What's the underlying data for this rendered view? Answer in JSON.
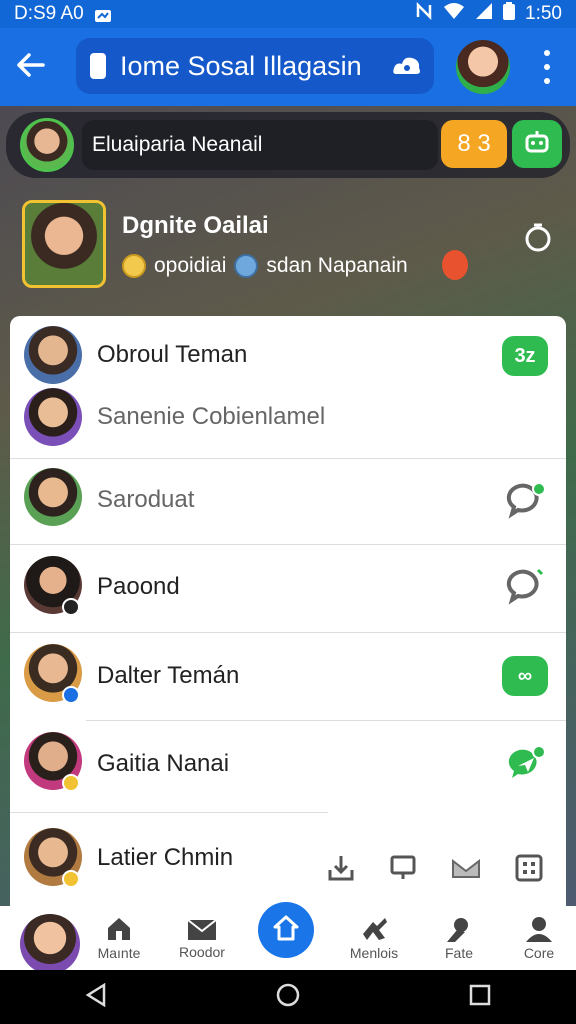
{
  "status_bar": {
    "time": "D:S9 A0",
    "clock_right": "1:50",
    "icons": [
      "message-icon",
      "nfc-icon",
      "wifi-icon",
      "signal-icon",
      "battery-icon"
    ]
  },
  "app_bar": {
    "title": "Iome Sosal Illagasin",
    "icons": [
      "back-arrow-icon",
      "cloud-icon",
      "more-vert-icon"
    ]
  },
  "search": {
    "value": "Eluaiparia Neanail",
    "badge_count": "8 3"
  },
  "profile": {
    "name": "Dgnite Oailai",
    "sub1": "opoidiai",
    "sub2": "sdan Napanain"
  },
  "list": [
    {
      "name": "Obroul Teman",
      "badge": "3z",
      "style": "normal"
    },
    {
      "name": "Sanenie Cobienlamel",
      "style": "muted"
    },
    {
      "name": "Saroduat",
      "style": "muted"
    },
    {
      "name": "Paoond",
      "style": "normal"
    },
    {
      "name": "Dalter Temán",
      "badge": "∞",
      "style": "normal"
    },
    {
      "name": "Gaitia Nanai",
      "style": "normal"
    },
    {
      "name": "Latier Chmin",
      "style": "normal"
    }
  ],
  "bottom_nav": [
    {
      "label": "Maınte",
      "icon": "house-icon"
    },
    {
      "label": "Roodor",
      "icon": "mail-icon"
    },
    {
      "label": "",
      "icon": "home-icon"
    },
    {
      "label": "Menlois",
      "icon": "puzzle-icon"
    },
    {
      "label": "Fate",
      "icon": "person-icon"
    },
    {
      "label": "Core",
      "icon": "profile-icon"
    }
  ],
  "colors": {
    "primary": "#1a6fe2",
    "accent_green": "#2fbb4f",
    "accent_orange": "#f5a623"
  }
}
